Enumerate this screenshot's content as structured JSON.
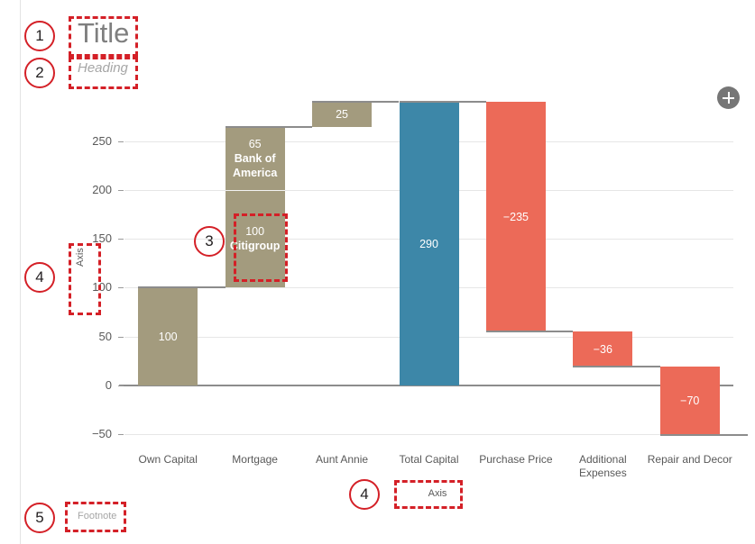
{
  "slide": {
    "title": "Title",
    "heading": "Heading",
    "footnote": "Footnote",
    "add_button_icon": "plus-icon"
  },
  "annotations": [
    {
      "number": "1",
      "target": "title"
    },
    {
      "number": "2",
      "target": "heading"
    },
    {
      "number": "3",
      "target": "data-label-citigroup"
    },
    {
      "number": "4",
      "target": "y-axis-title"
    },
    {
      "number": "4",
      "target": "x-axis-title"
    },
    {
      "number": "5",
      "target": "footnote"
    }
  ],
  "chart_data": {
    "type": "bar",
    "subtype": "waterfall-stacked",
    "title": "",
    "xlabel": "Axis",
    "ylabel": "Axis",
    "ylim": [
      -60,
      295
    ],
    "yticks": [
      250,
      200,
      150,
      100,
      50,
      0,
      -50
    ],
    "ytick_labels": [
      "250",
      "200",
      "150",
      "100",
      "50",
      "0",
      "−50"
    ],
    "grid": true,
    "legend": "none",
    "categories": [
      "Own Capital",
      "Mortgage",
      "Aunt Annie",
      "Total Capital",
      "Purchase Price",
      "Additional Expenses",
      "Repair and Decor"
    ],
    "bars": [
      {
        "category": "Own Capital",
        "kind": "increase",
        "color": "#a39b7e",
        "base": 0,
        "top": 100,
        "segments": [
          {
            "label": "100",
            "sublabel": "",
            "value": 100,
            "from": 0,
            "to": 100
          }
        ]
      },
      {
        "category": "Mortgage",
        "kind": "increase",
        "color": "#a39b7e",
        "base": 100,
        "top": 265,
        "segments": [
          {
            "label": "100",
            "sublabel": "Citigroup",
            "value": 100,
            "from": 100,
            "to": 200
          },
          {
            "label": "65",
            "sublabel": "Bank of America",
            "value": 65,
            "from": 200,
            "to": 265
          }
        ]
      },
      {
        "category": "Aunt Annie",
        "kind": "increase",
        "color": "#a39b7e",
        "base": 265,
        "top": 290,
        "segments": [
          {
            "label": "25",
            "sublabel": "",
            "value": 25,
            "from": 265,
            "to": 290
          }
        ]
      },
      {
        "category": "Total Capital",
        "kind": "total",
        "color": "#3d87a8",
        "base": 0,
        "top": 290,
        "segments": [
          {
            "label": "290",
            "sublabel": "",
            "value": 290,
            "from": 0,
            "to": 290
          }
        ]
      },
      {
        "category": "Purchase Price",
        "kind": "decrease",
        "color": "#ec6a58",
        "base": 55,
        "top": 290,
        "segments": [
          {
            "label": "−235",
            "sublabel": "",
            "value": -235,
            "from": 290,
            "to": 55
          }
        ]
      },
      {
        "category": "Additional Expenses",
        "kind": "decrease",
        "color": "#ec6a58",
        "base": 19,
        "top": 55,
        "segments": [
          {
            "label": "−36",
            "sublabel": "",
            "value": -36,
            "from": 55,
            "to": 19
          }
        ]
      },
      {
        "category": "Repair and Decor",
        "kind": "decrease",
        "color": "#ec6a58",
        "base": -51,
        "top": 19,
        "segments": [
          {
            "label": "−70",
            "sublabel": "",
            "value": -70,
            "from": 19,
            "to": -51
          }
        ]
      }
    ],
    "colors": {
      "increase": "#a39b7e",
      "total": "#3d87a8",
      "decrease": "#ec6a58",
      "gridline": "#e6e6e6",
      "axis": "#8c8c8c",
      "annotation": "#d42027"
    }
  }
}
